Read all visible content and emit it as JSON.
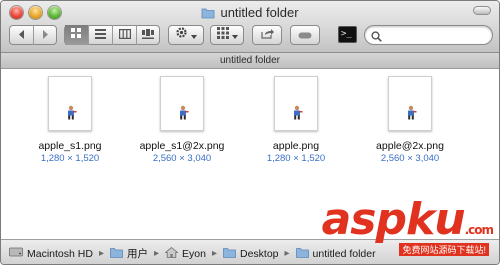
{
  "window": {
    "title": "untitled folder",
    "tab_label": "untitled folder"
  },
  "toolbar": {
    "search_placeholder": "",
    "view_mode_selected": "icon"
  },
  "files": [
    {
      "name": "apple_s1.png",
      "dimensions": "1,280 × 1,520"
    },
    {
      "name": "apple_s1@2x.png",
      "dimensions": "2,560 × 3,040"
    },
    {
      "name": "apple.png",
      "dimensions": "1,280 × 1,520"
    },
    {
      "name": "apple@2x.png",
      "dimensions": "2,560 × 3,040"
    }
  ],
  "path": [
    {
      "label": "Macintosh HD",
      "icon": "hard-drive-icon"
    },
    {
      "label": "用户",
      "icon": "folder-icon"
    },
    {
      "label": "Eyon",
      "icon": "home-icon"
    },
    {
      "label": "Desktop",
      "icon": "folder-icon"
    },
    {
      "label": "untitled folder",
      "icon": "folder-icon"
    }
  ],
  "watermark": {
    "logo": "aspku",
    "logo_suffix": ".com",
    "subtitle": "免费网站源码下载站!"
  },
  "colors": {
    "dimension_text": "#3a6fc6",
    "watermark_red": "#e0321e"
  }
}
